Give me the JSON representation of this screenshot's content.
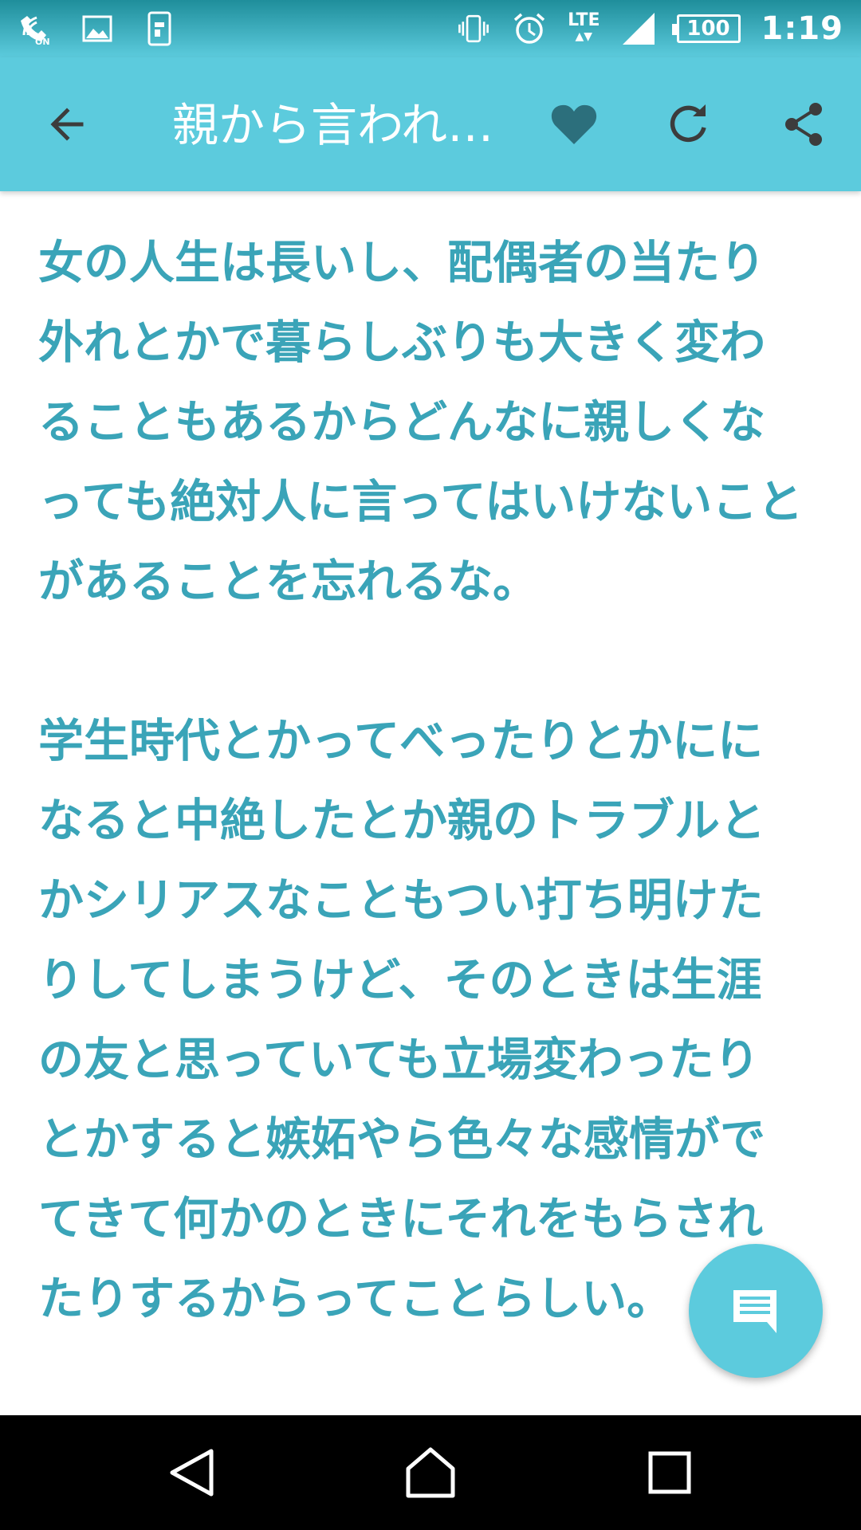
{
  "status_bar": {
    "left_icons": [
      "wifi-calling-on-icon",
      "image-notification-icon",
      "phone-sync-icon"
    ],
    "right_icons": [
      "vibrate-icon",
      "alarm-icon",
      "lte-icon",
      "signal-icon",
      "battery-icon"
    ],
    "lte_label": "LTE",
    "battery_level": "100",
    "time": "1:19"
  },
  "app_bar": {
    "title": "親から言われ…",
    "background_color": "#5ccbdd"
  },
  "content": {
    "paragraphs": [
      "女の人生は長いし、配偶者の当たり外れとかで暮らしぶりも大きく変わることもあるからどんなに親しくなっても絶対人に言ってはいけないことがあることを忘れるな。",
      "学生時代とかってべったりとかにになると中絶したとか親のトラブルとかシリアスなこともつい打ち明けたりしてしまうけど、そのときは生涯の友と思っていても立場変わったりとかすると嫉妬やら色々な感情がでてきて何かのときにそれをもらされたりするからってことらしい。"
    ],
    "text_color": "#3aa4b8"
  },
  "fab": {
    "icon": "comment-icon"
  },
  "nav_bar": {
    "icons": [
      "nav-back-icon",
      "nav-home-icon",
      "nav-recent-icon"
    ]
  }
}
